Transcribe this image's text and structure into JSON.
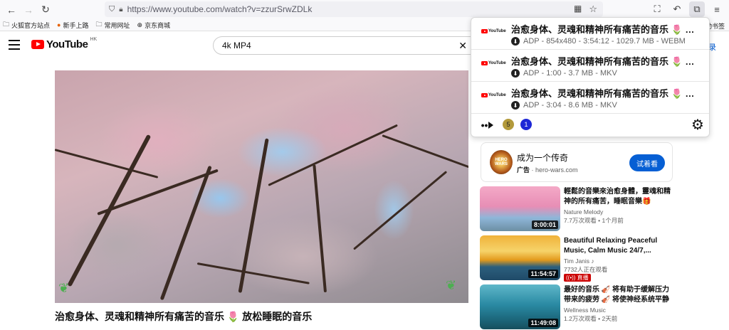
{
  "browser": {
    "url": "https://www.youtube.com/watch?v=zzurSrwZDLk",
    "bookmarks": [
      "火狐官方站点",
      "新手上路",
      "常用网址",
      "京东商城"
    ],
    "bookmarks_right": "动书签"
  },
  "youtube": {
    "logo_text": "YouTube",
    "region": "HK",
    "search_query": "4k MP4",
    "header_right_text": "录"
  },
  "video": {
    "title": "治愈身体、灵魂和精神所有痛苦的音乐 🌷 放松睡眠的音乐"
  },
  "downloader": {
    "items": [
      {
        "title": "治愈身体、灵魂和精神所有痛苦的音乐 🌷 放松睡眠的音乐",
        "meta": "ADP - 854x480 - 3:54:12 - 1029.7 MB - WEBM"
      },
      {
        "title": "治愈身体、灵魂和精神所有痛苦的音乐 🌷 放松睡眠的音乐",
        "meta": "ADP - 1:00 - 3.7 MB - MKV"
      },
      {
        "title": "治愈身体、灵魂和精神所有痛苦的音乐 🌷 放松睡眠的音乐",
        "meta": "ADP - 3:04 - 8.6 MB - MKV"
      }
    ],
    "yt_label": "YouTube",
    "more_label": "•••",
    "badge_olive": "5",
    "badge_blue": "1"
  },
  "ad": {
    "logo_text": "HERO WARS",
    "title": "成为一个传奇",
    "tag": "广告",
    "domain": "hero-wars.com",
    "button": "试着看"
  },
  "recommendations": [
    {
      "title": "輕鬆的音樂來治愈身體，靈魂和精神的所有痛苦，睡眠音樂🎁",
      "channel": "Nature Melody",
      "stats": "7.7万次观看 • 1个月前",
      "duration": "8:00:01"
    },
    {
      "title": "Beautiful Relaxing Peaceful Music, Calm Music 24/7,...",
      "channel": "Tim Janis ♪",
      "stats": "7732人正在观看",
      "live": "((•)) 直播",
      "duration": "11:54:57"
    },
    {
      "title": "最好的音乐 🎻 将有助于缓解压力带来的疲劳 🎻 将使神经系统平静",
      "channel": "Wellness Music",
      "stats": "1.2万次观看 • 2天前",
      "duration": "11:49:08"
    }
  ]
}
